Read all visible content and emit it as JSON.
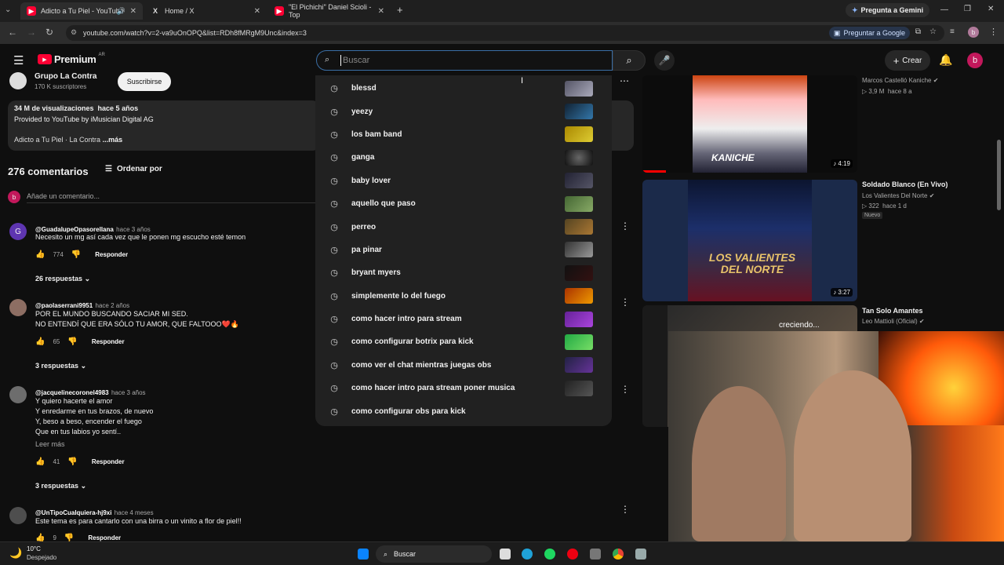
{
  "browser": {
    "tabs": [
      {
        "title": "Adicto a Tu Piel - YouTube",
        "active": true
      },
      {
        "title": "Home / X",
        "active": false
      },
      {
        "title": "\"El Pichichi\" Daniel Scioli - Top",
        "active": false
      }
    ],
    "gemini_label": "Pregunta a Gemini",
    "url": "youtube.com/watch?v=2-va9uOnOPQ&list=RDh8fMRgM9Unc&index=3",
    "google_label": "Preguntar a Google"
  },
  "header": {
    "logo": "Premium",
    "logo_region": "AR",
    "search_placeholder": "Buscar",
    "create_label": "Crear",
    "avatar_letter": "b"
  },
  "channel": {
    "name": "Grupo La Contra",
    "subs": "170 K suscriptores",
    "subscribe_label": "Suscribirse"
  },
  "description": {
    "stats": "34 M de visualizaciones  hace 5 años",
    "line1": "Provided to YouTube by iMusician Digital AG",
    "line2": "Adicto a Tu Piel · La Contra",
    "more": "...más"
  },
  "comments": {
    "count": "276 comentarios",
    "sort_label": "Ordenar por",
    "add_placeholder": "Añade un comentario...",
    "items": [
      {
        "user": "@GuadalupeOpasorellana",
        "time": "hace 3 años",
        "lines": [
          "Necesito un mg así cada vez que le ponen mg escucho esté temon"
        ],
        "likes": "774",
        "reply": "Responder",
        "replies": "26 respuestas"
      },
      {
        "user": "@paolaserrani9951",
        "time": "hace 2 años",
        "lines": [
          "POR EL MUNDO BUSCANDO SACIAR MI SED.",
          "NO ENTENDÍ QUE ERA SÓLO TU AMOR, QUE FALTOOO❤️🔥"
        ],
        "likes": "65",
        "reply": "Responder",
        "replies": "3 respuestas"
      },
      {
        "user": "@jacquelinecoronel4983",
        "time": "hace 3 años",
        "lines": [
          "Y quiero hacerte el amor",
          "Y enredarme en tus brazos, de nuevo",
          "Y, beso a beso, encender el fuego",
          "Que en tus labios yo sentí.."
        ],
        "read_more": "Leer más",
        "likes": "41",
        "reply": "Responder",
        "replies": "3 respuestas"
      },
      {
        "user": "@UnTipoCualquiera-hj9xi",
        "time": "hace 4 meses",
        "lines": [
          "Este tema es para cantarlo con una birra o un vinito a flor de piel!!"
        ],
        "likes": "9",
        "reply": "Responder"
      }
    ]
  },
  "suggestions": [
    "blessd",
    "yeezy",
    "los bam band",
    "ganga",
    "baby lover",
    "aquello que paso",
    "perreo",
    "pa pinar",
    "bryant myers",
    "simplemente lo del fuego",
    "como hacer intro para stream",
    "como configurar botrix para kick",
    "como ver el chat mientras juegas obs",
    "como hacer intro para stream poner musica",
    "como configurar obs para kick"
  ],
  "sidebar_videos": [
    {
      "channel": "Marcos Castelló Kaniche",
      "meta": "3,9 M  hace 8 a",
      "duration": "4:19",
      "thumb_text": "KANICHE"
    },
    {
      "title": "Soldado Blanco (En Vivo)",
      "channel": "Los Valientes Del Norte",
      "meta": "322  hace 1 d",
      "badge": "Nuevo",
      "duration": "3:27",
      "thumb_text": "LOS VALIENTES DEL NORTE"
    },
    {
      "title": "Tan Solo Amantes",
      "channel": "Leo Mattioli (Oficial)",
      "overlay": "creciendo..."
    }
  ],
  "taskbar": {
    "temp": "10°C",
    "weather": "Despejado",
    "search_label": "Buscar"
  }
}
